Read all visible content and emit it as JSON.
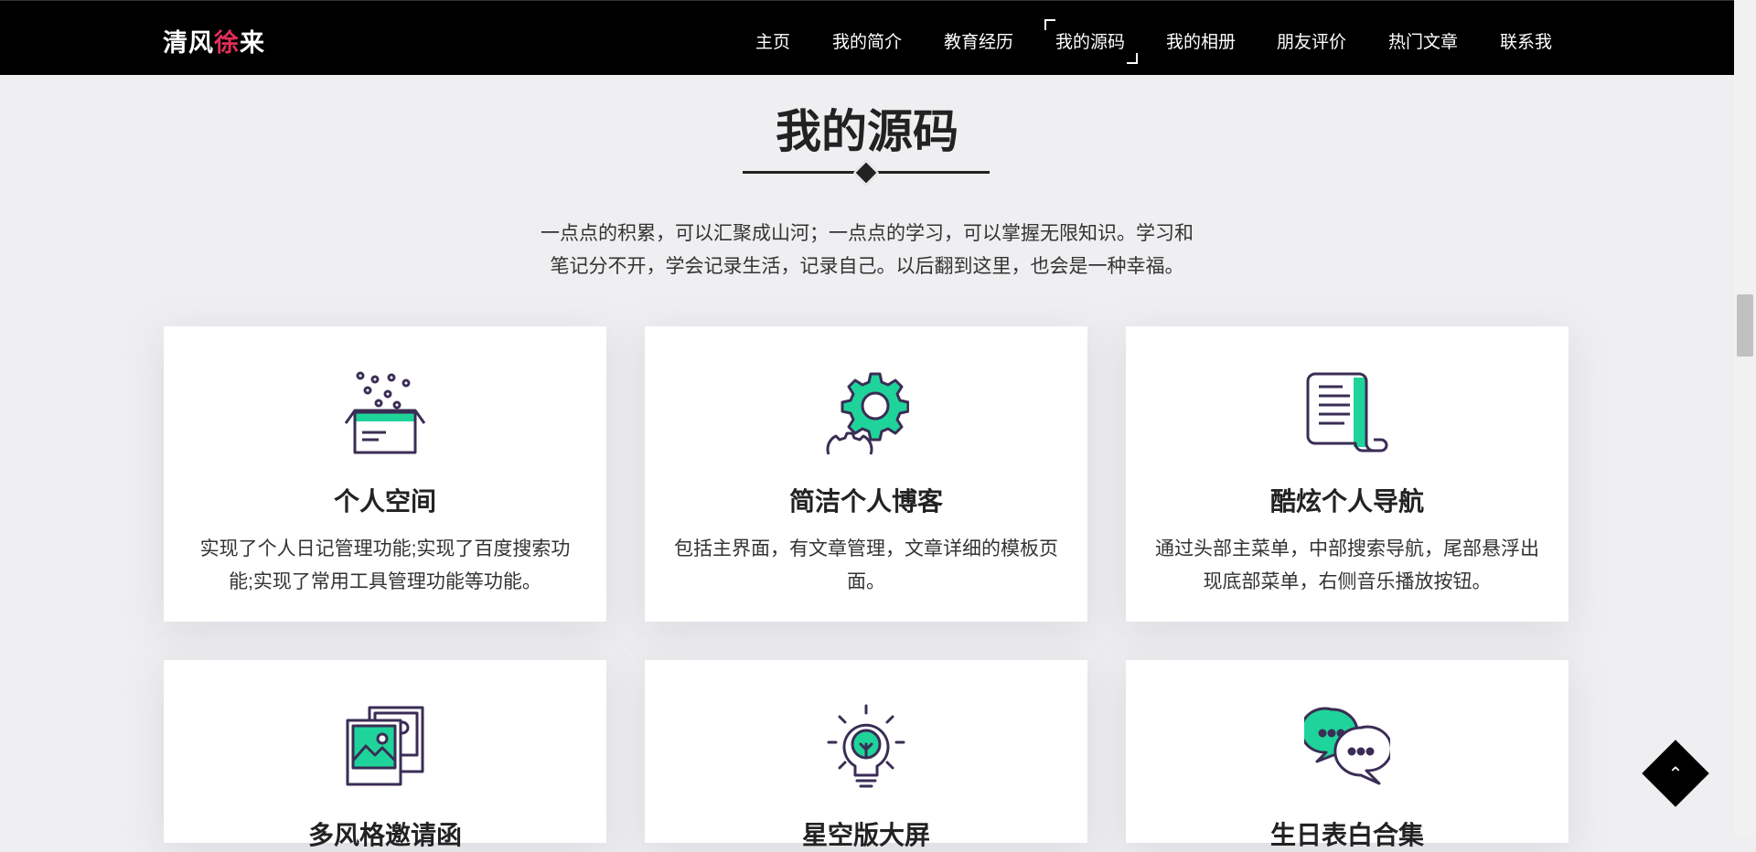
{
  "header": {
    "logo": {
      "part1": "清风",
      "part2": "徐",
      "part3": "来"
    },
    "nav": [
      {
        "label": "主页"
      },
      {
        "label": "我的简介"
      },
      {
        "label": "教育经历"
      },
      {
        "label": "我的源码",
        "active": true
      },
      {
        "label": "我的相册"
      },
      {
        "label": "朋友评价"
      },
      {
        "label": "热门文章"
      },
      {
        "label": "联系我"
      }
    ]
  },
  "section": {
    "title": "我的源码",
    "intro_line1": "一点点的积累，可以汇聚成山河；一点点的学习，可以掌握无限知识。学习和",
    "intro_line2": "笔记分不开，学会记录生活，记录自己。以后翻到这里，也会是一种幸福。"
  },
  "cards": [
    {
      "icon": "box-icon",
      "title": "个人空间",
      "desc": "实现了个人日记管理功能;实现了百度搜索功能;实现了常用工具管理功能等功能。"
    },
    {
      "icon": "gear-icon",
      "title": "简洁个人博客",
      "desc": "包括主界面，有文章管理，文章详细的模板页面。"
    },
    {
      "icon": "document-icon",
      "title": "酷炫个人导航",
      "desc": "通过头部主菜单，中部搜索导航，尾部悬浮出现底部菜单，右侧音乐播放按钮。"
    },
    {
      "icon": "image-gallery-icon",
      "title": "多风格邀请函",
      "desc": ""
    },
    {
      "icon": "lightbulb-icon",
      "title": "星空版大屏",
      "desc": ""
    },
    {
      "icon": "chat-bubbles-icon",
      "title": "生日表白合集",
      "desc": ""
    }
  ],
  "colors": {
    "accent": "#1fd49a",
    "outline": "#3a2d55",
    "logo_accent": "#e0305a",
    "header_bg": "#000000"
  },
  "back_to_top": {
    "icon": "chevron-up-icon",
    "glyph": "⌃"
  }
}
